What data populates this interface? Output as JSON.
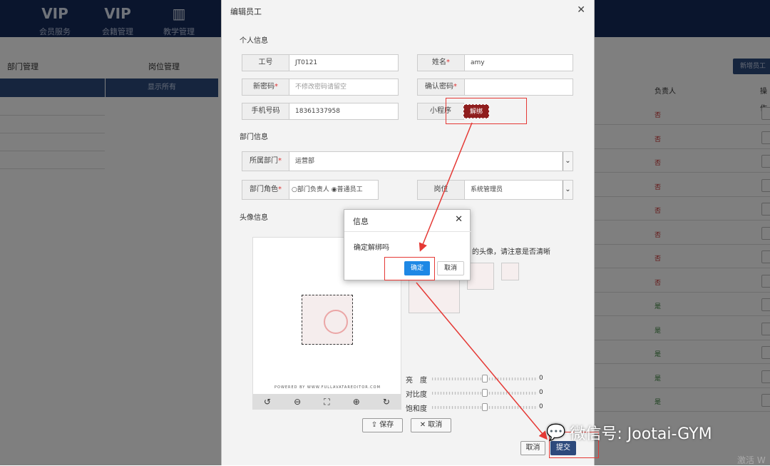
{
  "nav": {
    "items": [
      {
        "icon": "VIP",
        "label": "会员服务"
      },
      {
        "icon": "VIP",
        "label": "会籍管理"
      },
      {
        "icon": "▥",
        "label": "教学管理"
      }
    ]
  },
  "left": {
    "dept_title": "部门管理",
    "post_title": "岗位管理",
    "show_all": "显示所有"
  },
  "right": {
    "new_button": "新增员工",
    "col_head": "负责人",
    "col_op": "操作",
    "rows": [
      "否",
      "否",
      "否",
      "否",
      "否",
      "否",
      "否",
      "否",
      "是",
      "是",
      "是",
      "是",
      "是"
    ]
  },
  "colors": {
    "no": "#c62828",
    "yes": "#2e7d32",
    "accent": "#2d4a7c"
  },
  "modal": {
    "title": "编辑员工",
    "personal_section": "个人信息",
    "fields": {
      "id_label": "工号",
      "id_value": "JT0121",
      "name_label": "姓名",
      "name_value": "amy",
      "pwd_label": "新密码",
      "pwd_placeholder": "不修改密码请留空",
      "confirm_label": "确认密码",
      "phone_label": "手机号码",
      "phone_value": "18361337958",
      "miniapp_label": "小程序",
      "unbind_label": "解绑"
    },
    "dept_section": "部门信息",
    "dept_label": "所属部门",
    "dept_value": "运营部",
    "role_label": "部门角色",
    "role_opt1": "部门负责人",
    "role_opt2": "普通员工",
    "post_label": "岗位",
    "post_value": "系统管理员",
    "avatar_section": "头像信息",
    "avatar_hint": "的头像，请注意是否清晰",
    "powered": "POWERED BY WWW.FULLAVATAREDITOR.COM",
    "sliders": [
      {
        "label": "亮　度",
        "value": "0"
      },
      {
        "label": "对比度",
        "value": "0"
      },
      {
        "label": "饱和度",
        "value": "0"
      }
    ],
    "save_label": "保存",
    "cancel_label": "取消",
    "footer_cancel": "取消",
    "footer_submit": "提交"
  },
  "dialog": {
    "title": "信息",
    "message": "确定解绑吗",
    "ok": "确定",
    "cancel": "取消"
  },
  "watermark": "微信号: Jootai-GYM",
  "activate": "激活 W"
}
